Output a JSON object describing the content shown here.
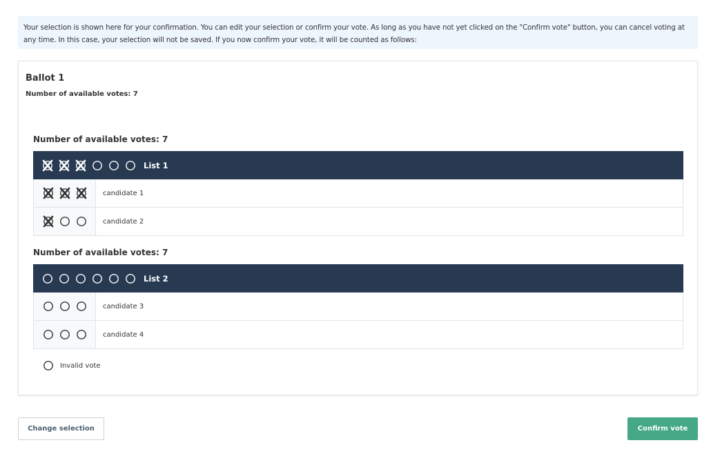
{
  "info_text": "Your selection is shown here for your confirmation. You can edit your selection or confirm your vote. As long as you have not yet clicked on the \"Confirm vote\" button, you can cancel voting at any time. In this case, your selection will not be saved. If you now confirm your vote, it will be counted as follows:",
  "ballot": {
    "title": "Ballot 1",
    "available_votes_label": "Number of available votes: 7",
    "lists": [
      {
        "available_votes_label": "Number of available votes: 7",
        "name": "List 1",
        "list_marks": [
          "crossed",
          "crossed",
          "crossed",
          "empty",
          "empty",
          "empty"
        ],
        "candidates": [
          {
            "name": "candidate 1",
            "marks": [
              "crossed",
              "crossed",
              "crossed"
            ]
          },
          {
            "name": "candidate 2",
            "marks": [
              "crossed",
              "empty",
              "empty"
            ]
          }
        ]
      },
      {
        "available_votes_label": "Number of available votes: 7",
        "name": "List 2",
        "list_marks": [
          "empty",
          "empty",
          "empty",
          "empty",
          "empty",
          "empty"
        ],
        "candidates": [
          {
            "name": "candidate 3",
            "marks": [
              "empty",
              "empty",
              "empty"
            ]
          },
          {
            "name": "candidate 4",
            "marks": [
              "empty",
              "empty",
              "empty"
            ]
          }
        ]
      }
    ],
    "invalid_vote": {
      "label": "Invalid vote",
      "checked": false
    }
  },
  "buttons": {
    "change_selection": "Change selection",
    "confirm_vote": "Confirm vote"
  },
  "colors": {
    "header_bg": "#283a52",
    "confirm_bg": "#45a886",
    "info_bg": "#eef6fd"
  }
}
